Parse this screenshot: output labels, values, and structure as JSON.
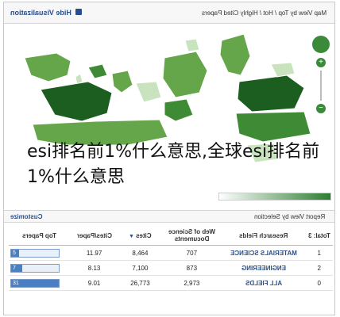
{
  "header": {
    "hide_label": "Hide Visualization",
    "map_title": "Map View by Top / Hot / Highly Cited Papers"
  },
  "overlay_text": "esi排名前1%什么意思,全球esi排名前1%什么意思",
  "report": {
    "title": "Report View by Selection",
    "customize_label": "Customize",
    "columns": [
      "Total: 3",
      "Research Fields",
      "Web of Science Documents",
      "Cites",
      "Cites/Paper",
      "Top Papers"
    ],
    "rows": [
      {
        "rank": "1",
        "field": "MATERIALS SCIENCE",
        "docs": "707",
        "cites": "8,464",
        "cites_per_paper": "11.97",
        "top_papers": "5",
        "top_fraction": 0.16
      },
      {
        "rank": "2",
        "field": "ENGINEERING",
        "docs": "873",
        "cites": "7,100",
        "cites_per_paper": "8.13",
        "top_papers": "7",
        "top_fraction": 0.23
      },
      {
        "rank": "0",
        "field": "ALL FIELDS",
        "docs": "2,973",
        "cites": "26,773",
        "cites_per_paper": "9.01",
        "top_papers": "31",
        "top_fraction": 1.0
      }
    ]
  },
  "colors": {
    "link": "#2a4e8a",
    "map_dark": "#1b5e20",
    "map_mid": "#66a64a",
    "map_light": "#c8e3bd",
    "bar": "#4a7fc1"
  }
}
